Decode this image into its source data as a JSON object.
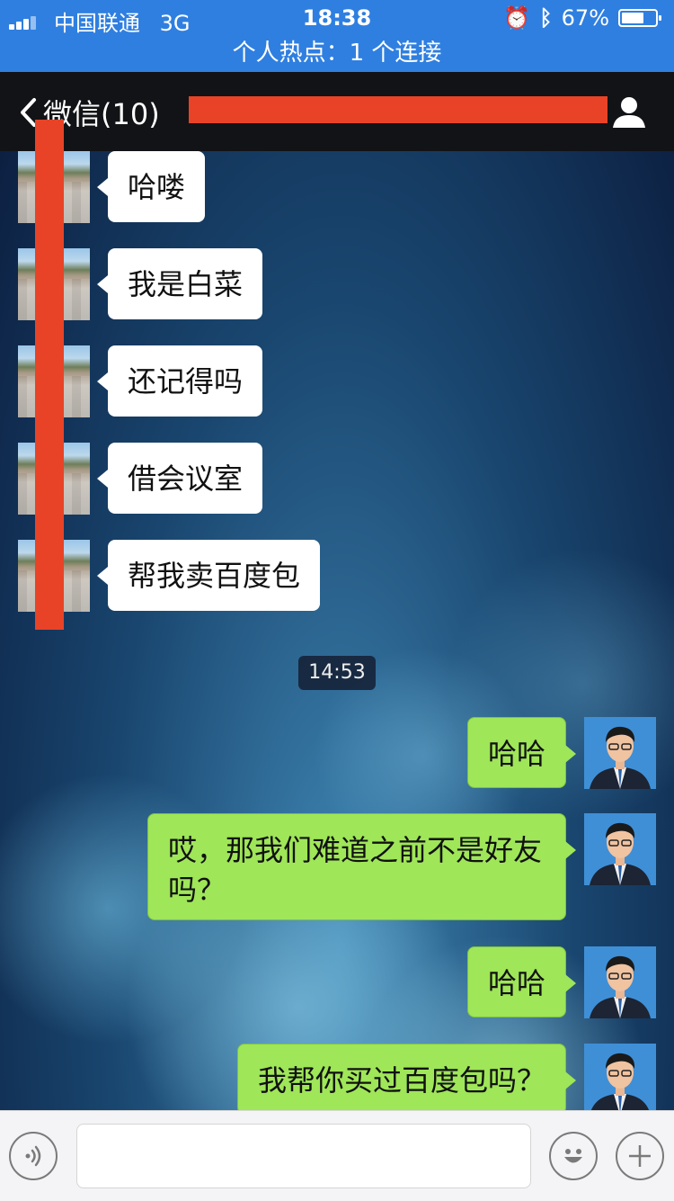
{
  "status_bar": {
    "carrier": "中国联通",
    "network": "3G",
    "time": "18:38",
    "battery_percent": "67%",
    "battery_level": 0.67
  },
  "hotspot_banner": "个人热点：1 个连接",
  "nav": {
    "back_label": "微信(10)"
  },
  "messages_in": [
    {
      "text": "哈喽"
    },
    {
      "text": "我是白菜"
    },
    {
      "text": "还记得吗"
    },
    {
      "text": "借会议室"
    },
    {
      "text": "帮我卖百度包"
    }
  ],
  "timestamp": "14:53",
  "messages_out": [
    {
      "text": "哈哈"
    },
    {
      "text": "哎，那我们难道之前不是好友吗？"
    },
    {
      "text": "哈哈"
    },
    {
      "text": "我帮你买过百度包吗？"
    }
  ],
  "colors": {
    "status_bar": "#2f7fe0",
    "nav_bar": "#121316",
    "outgoing_bubble": "#9fe658",
    "incoming_bubble": "#ffffff",
    "redaction": "#e84327"
  }
}
